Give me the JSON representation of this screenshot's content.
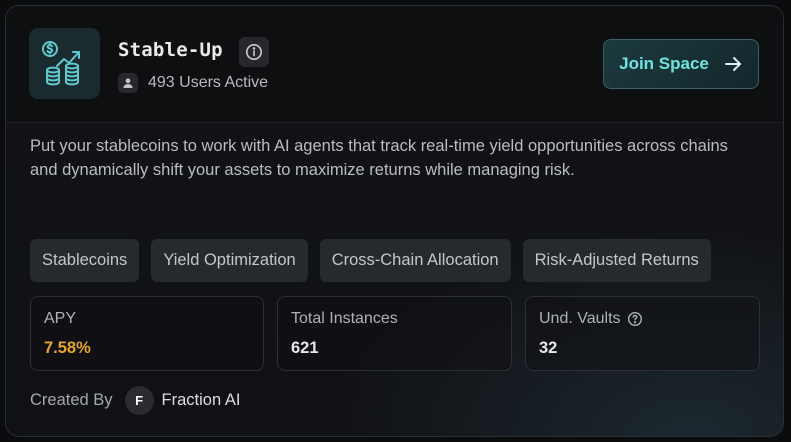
{
  "space": {
    "title": "Stable-Up",
    "users_active": "493 Users Active",
    "join_label": "Join Space",
    "description": "Put your stablecoins to work with AI agents that track real-time yield opportunities across chains and dynamically shift your assets to maximize returns while managing risk."
  },
  "tags": [
    "Stablecoins",
    "Yield Optimization",
    "Cross-Chain Allocation",
    "Risk-Adjusted Returns"
  ],
  "stats": {
    "apy": {
      "label": "APY",
      "value": "7.58%"
    },
    "instances": {
      "label": "Total Instances",
      "value": "621"
    },
    "vaults": {
      "label": "Und. Vaults",
      "value": "32"
    }
  },
  "creator": {
    "label": "Created By",
    "initial": "F",
    "name": "Fraction AI"
  },
  "icons": {
    "logo": "coins-growth-icon",
    "info": "info-icon",
    "user": "user-icon",
    "join": "arrow-right-icon",
    "help": "question-circle-icon"
  },
  "colors": {
    "accent": "#6fe3e0",
    "apy": "#e3a72b",
    "logo_bg": "#1b2a2f"
  }
}
